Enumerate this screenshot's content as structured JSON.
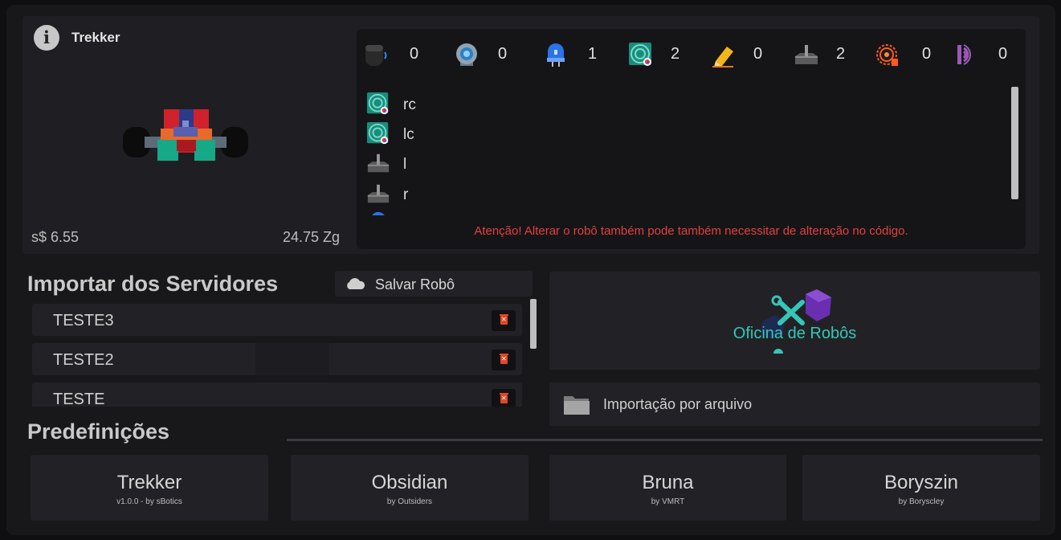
{
  "robot": {
    "name": "Trekker",
    "price": "s$ 6.55",
    "weight": "24.75 Zg"
  },
  "sensor_counts": [
    {
      "icon": "ultrasonic-sensor-icon",
      "count": "0"
    },
    {
      "icon": "camera-sensor-icon",
      "count": "0"
    },
    {
      "icon": "led-icon",
      "count": "1"
    },
    {
      "icon": "color-sensor-icon",
      "count": "2"
    },
    {
      "icon": "pen-icon",
      "count": "0"
    },
    {
      "icon": "motor-icon",
      "count": "2"
    },
    {
      "icon": "lidar-sensor-icon",
      "count": "0"
    },
    {
      "icon": "sound-sensor-icon",
      "count": "0"
    }
  ],
  "sensor_list": [
    {
      "icon": "color-sensor-icon",
      "label": "rc"
    },
    {
      "icon": "color-sensor-icon",
      "label": "lc"
    },
    {
      "icon": "motor-icon",
      "label": "l"
    },
    {
      "icon": "motor-icon",
      "label": "r"
    },
    {
      "icon": "led-icon",
      "label": ""
    }
  ],
  "warning": "Atenção! Alterar o robô também pode também necessitar de alteração no código.",
  "import": {
    "title": "Importar dos Servidores",
    "save_label": "Salvar Robô",
    "servers": [
      "TESTE3",
      "TESTE2",
      "TESTE"
    ]
  },
  "workshop": {
    "label": "Oficina de Robôs"
  },
  "file_import": {
    "label": "Importação por arquivo"
  },
  "presets": {
    "title": "Predefinições",
    "items": [
      {
        "name": "Trekker",
        "by": "v1.0.0 - by sBotics"
      },
      {
        "name": "Obsidian",
        "by": "by Outsiders"
      },
      {
        "name": "Bruna",
        "by": "by VMRT"
      },
      {
        "name": "Boryszin",
        "by": "by Boryscley"
      }
    ]
  },
  "colors": {
    "warning": "#e2403e",
    "workshop_accent": "#35c6b8",
    "delete_icon": "#e24822"
  }
}
